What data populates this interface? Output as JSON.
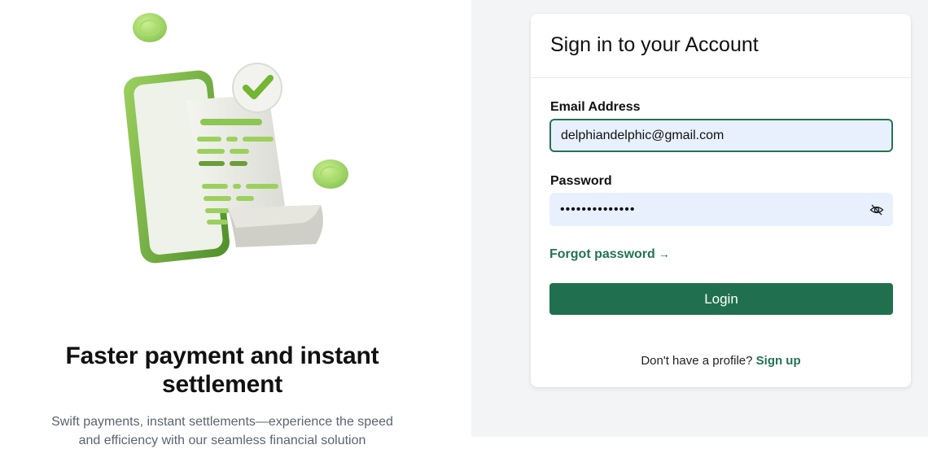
{
  "promo": {
    "title": "Faster payment and instant settlement",
    "description": "Swift payments, instant settlements—experience the speed and efficiency with our seamless financial solution"
  },
  "login": {
    "title": "Sign in to your Account",
    "email_label": "Email Address",
    "email_value": "delphiandelphic@gmail.com",
    "password_label": "Password",
    "password_value": "••••••••••••••",
    "password_toggle_icon": "eye-off-icon",
    "forgot_label": "Forgot password",
    "forgot_arrow": "→",
    "login_label": "Login",
    "signup_prompt": "Don't have a profile?",
    "signup_label": "Sign up"
  },
  "colors": {
    "brand_green": "#20704f",
    "input_bg": "#e8f0fe",
    "panel_bg": "#f3f4f6"
  }
}
